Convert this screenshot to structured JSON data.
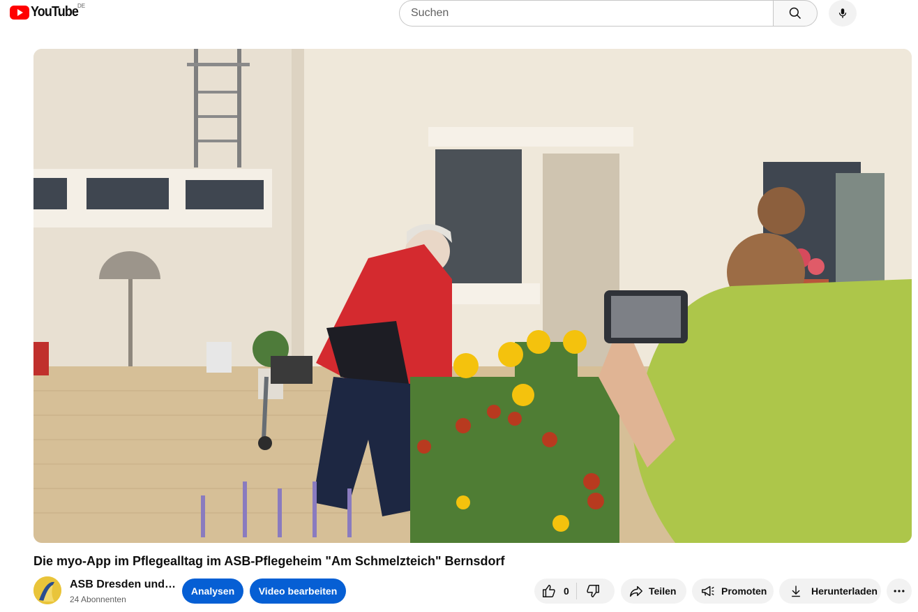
{
  "header": {
    "logo_text": "YouTube",
    "region_code": "DE",
    "search_placeholder": "Suchen"
  },
  "video": {
    "title": "Die myo-App im Pflegealltag im ASB-Pflegeheim \"Am Schmelzteich\" Bernsdorf"
  },
  "channel": {
    "name": "ASB Dresden und…",
    "subscribers": "24 Abonnenten"
  },
  "actions": {
    "analytics_label": "Analysen",
    "edit_video_label": "Video bearbeiten",
    "like_count": "0",
    "share_label": "Teilen",
    "promote_label": "Promoten",
    "download_label": "Herunterladen"
  },
  "icons": {
    "search": "search-icon",
    "mic": "mic-icon",
    "like": "thumbs-up-icon",
    "dislike": "thumbs-down-icon",
    "share": "share-icon",
    "promote": "megaphone-icon",
    "download": "download-icon",
    "more": "more-horizontal-icon"
  },
  "colors": {
    "brand_red": "#ff0000",
    "accent_blue": "#065fd4",
    "pill_bg": "#f2f2f2"
  }
}
